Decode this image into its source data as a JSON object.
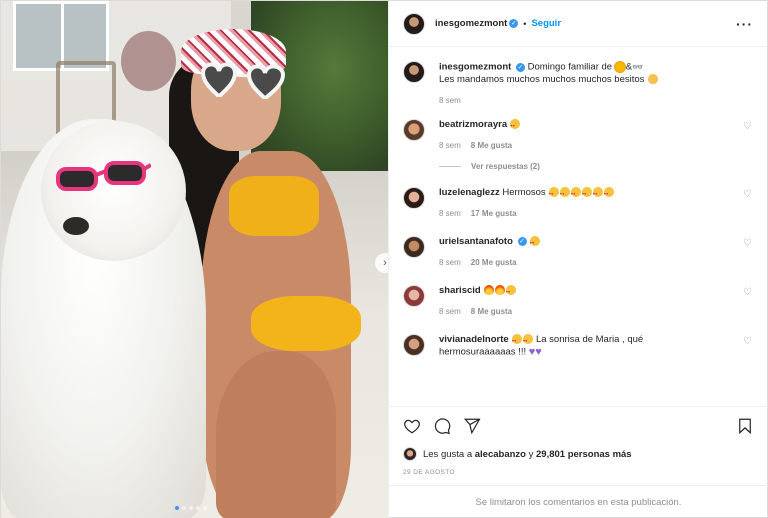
{
  "post": {
    "owner": "inesgomezmont",
    "follow_label": "Seguir",
    "caption_line1": "Domingo familiar de",
    "caption_line2": "Les mandamos muchos muchos muchos besitos",
    "caption_time": "8 sem"
  },
  "comments": [
    {
      "user": "beatrizmorayra",
      "text": "",
      "time": "8 sem",
      "likes": "8 Me gusta"
    },
    {
      "user": "luzelenaglezz",
      "text": "Hermosos",
      "time": "8 sem",
      "likes": "17 Me gusta"
    },
    {
      "user": "urielsantanafoto",
      "text": "",
      "time": "8 sem",
      "likes": "20 Me gusta"
    },
    {
      "user": "shariscid",
      "text": "",
      "time": "8 sem",
      "likes": "8 Me gusta"
    },
    {
      "user": "vivianadelnorte",
      "text_a": "La sonrisa de Maria , qué",
      "text_b": "hermosuraaaaaas !!!"
    }
  ],
  "replies_label": "Ver respuestas (2)",
  "likes": {
    "prefix": "Les gusta a",
    "user": "alecabanzo",
    "conj": "y",
    "count": "29,801 personas más"
  },
  "date": "29 DE AGOSTO",
  "comments_limited": "Se limitaron los comentarios en esta publicación.",
  "icons": [
    "heart-icon",
    "comment-icon",
    "share-icon",
    "bookmark-icon",
    "more-icon",
    "verified-icon",
    "chevron-right-icon"
  ],
  "colors": {
    "accent": "#0095f6",
    "verified": "#3897f0",
    "muted": "#8e8e8e"
  }
}
